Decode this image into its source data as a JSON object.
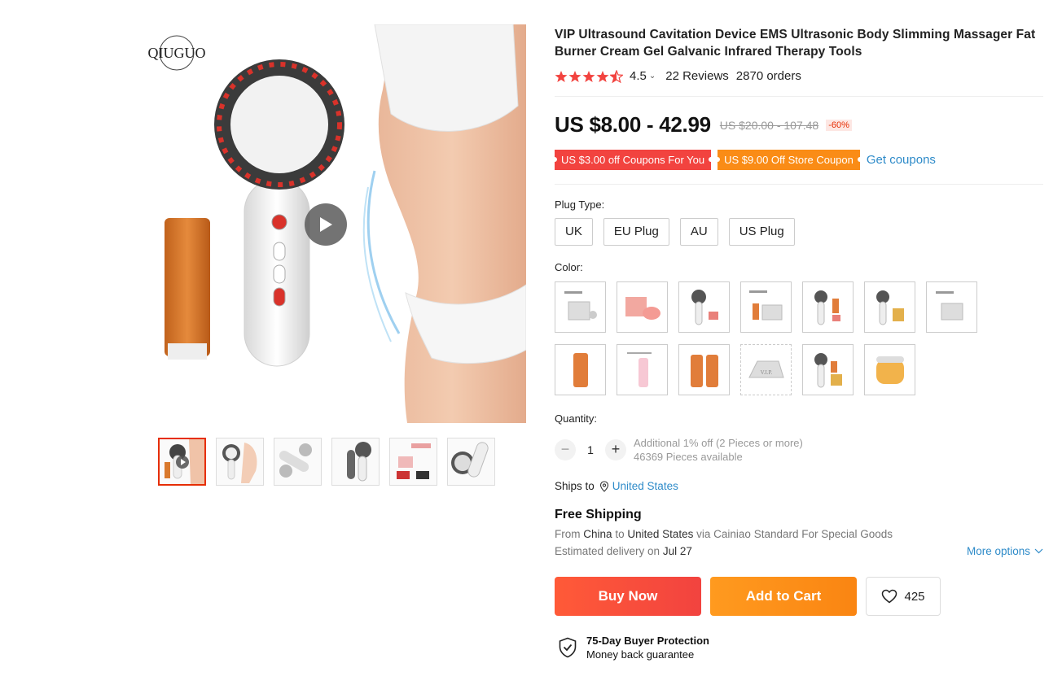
{
  "gallery": {
    "brand": "QIUGUO",
    "thumbnails": [
      "thumb-1",
      "thumb-2",
      "thumb-3",
      "thumb-4",
      "thumb-5",
      "thumb-6"
    ]
  },
  "product": {
    "title": "VIP Ultrasound Cavitation Device EMS Ultrasonic Body Slimming Massager Fat Burner Cream Gel Galvanic Infrared Therapy Tools",
    "rating": "4.5",
    "reviews": "22 Reviews",
    "orders": "2870 orders",
    "price": "US $8.00 - 42.99",
    "original_price": "US $20.00 - 107.48",
    "discount": "-60%",
    "coupons": {
      "coupon_1": "US $3.00 off Coupons For You",
      "coupon_2": "US $9.00 Off Store Coupon",
      "get_coupons": "Get coupons"
    }
  },
  "options": {
    "plug_label": "Plug Type:",
    "plugs": [
      "UK",
      "EU Plug",
      "AU",
      "US Plug"
    ],
    "color_label": "Color:"
  },
  "quantity": {
    "label": "Quantity:",
    "value": "1",
    "minus": "−",
    "plus": "+",
    "bulk_note": "Additional 1% off (2 Pieces or more)",
    "available": "46369 Pieces available"
  },
  "shipping": {
    "ships_to_label": "Ships to",
    "country": "United States",
    "free_shipping": "Free Shipping",
    "from_label": "From",
    "from": "China",
    "to_label": "to",
    "to": "United States",
    "via": "via Cainiao Standard For Special Goods",
    "eta_label": "Estimated delivery on",
    "eta": "Jul 27",
    "more_options": "More options"
  },
  "actions": {
    "buy_now": "Buy Now",
    "add_to_cart": "Add to Cart",
    "wishlist_count": "425"
  },
  "protection": {
    "title": "75-Day Buyer Protection",
    "subtitle": "Money back guarantee"
  },
  "colors": {
    "accent_red": "#e62e04",
    "star_red": "#f2433f",
    "link_blue": "#2e8bc9",
    "orange": "#fa8c16"
  }
}
